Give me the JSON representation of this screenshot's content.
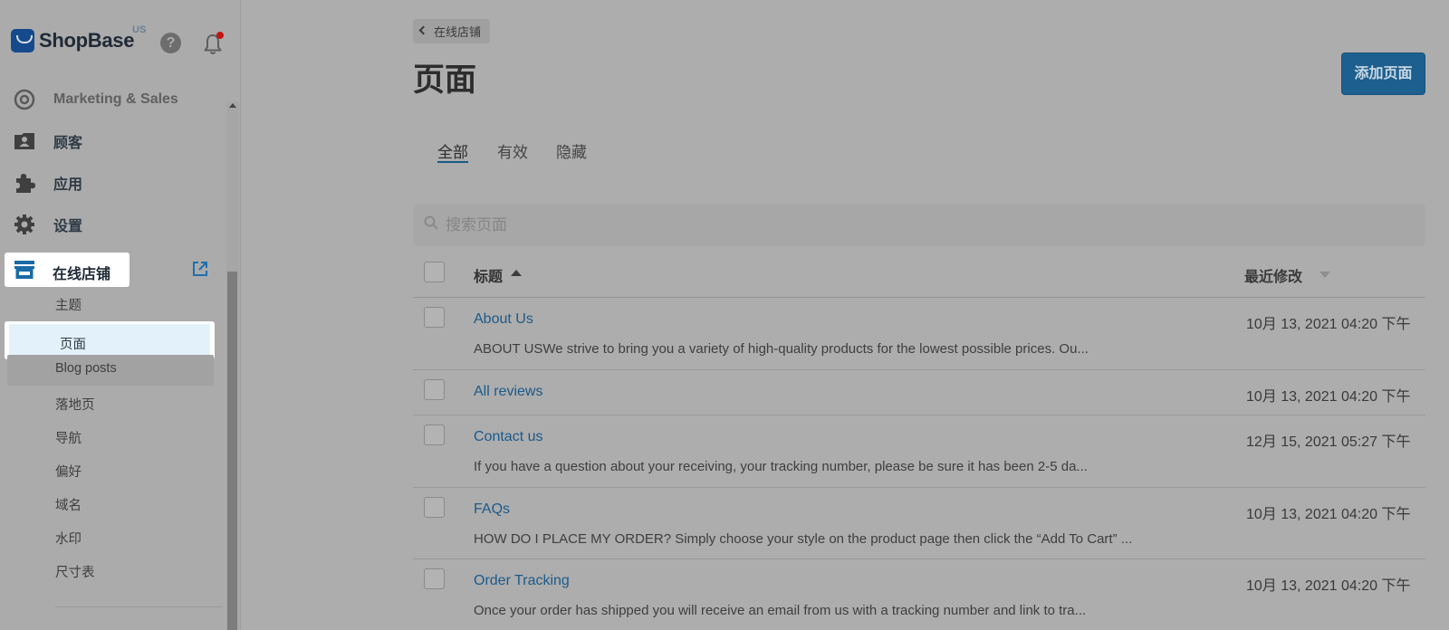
{
  "sidebar": {
    "brand": {
      "name": "ShopBase",
      "region": "US"
    },
    "help_glyph": "?",
    "icons": {
      "help": "help-circle-icon",
      "notifications": "bell-icon"
    },
    "items": [
      {
        "label": "Marketing & Sales",
        "icon": "target-icon"
      },
      {
        "label": "顾客",
        "icon": "customer-card-icon"
      },
      {
        "label": "应用",
        "icon": "puzzle-piece-icon"
      },
      {
        "label": "设置",
        "icon": "gear-icon"
      },
      {
        "label": "在线店铺",
        "icon": "storefront-icon"
      }
    ],
    "sub_items": [
      "主题",
      "页面",
      "Blog posts",
      "落地页",
      "导航",
      "偏好",
      "域名",
      "水印",
      "尺寸表"
    ],
    "active_sub_item": "页面"
  },
  "header": {
    "back_label": "在线店铺",
    "title": "页面",
    "add_button_label": "添加页面"
  },
  "tabs": [
    "全部",
    "有效",
    "隐藏"
  ],
  "active_tab": "全部",
  "search": {
    "placeholder": "搜索页面",
    "value": ""
  },
  "table": {
    "columns": [
      "标题",
      "最近修改"
    ],
    "rows": [
      {
        "title": "About Us",
        "modified": "10月 13, 2021 04:20 下午",
        "excerpt": "ABOUT USWe strive to bring you a variety of high-quality products for the lowest possible prices. Ou..."
      },
      {
        "title": "All reviews",
        "modified": "10月 13, 2021 04:20 下午",
        "excerpt": ""
      },
      {
        "title": "Contact us",
        "modified": "12月 15, 2021 05:27 下午",
        "excerpt": "If you have a question about your receiving, your tracking number, please be sure it has been 2-5 da..."
      },
      {
        "title": "FAQs",
        "modified": "10月 13, 2021 04:20 下午",
        "excerpt": "HOW DO I PLACE MY ORDER?  Simply choose your style on the product page then click the “Add To Cart” ..."
      },
      {
        "title": "Order Tracking",
        "modified": "10月 13, 2021 04:20 下午",
        "excerpt": "Once your order has shipped you will receive an email from us with a tracking number and link to tra..."
      }
    ]
  },
  "colors": {
    "accent": "#1d5f8e",
    "link": "#1c5a8a",
    "notification_dot": "#c31414",
    "active_bg": "#e3f1fa"
  }
}
